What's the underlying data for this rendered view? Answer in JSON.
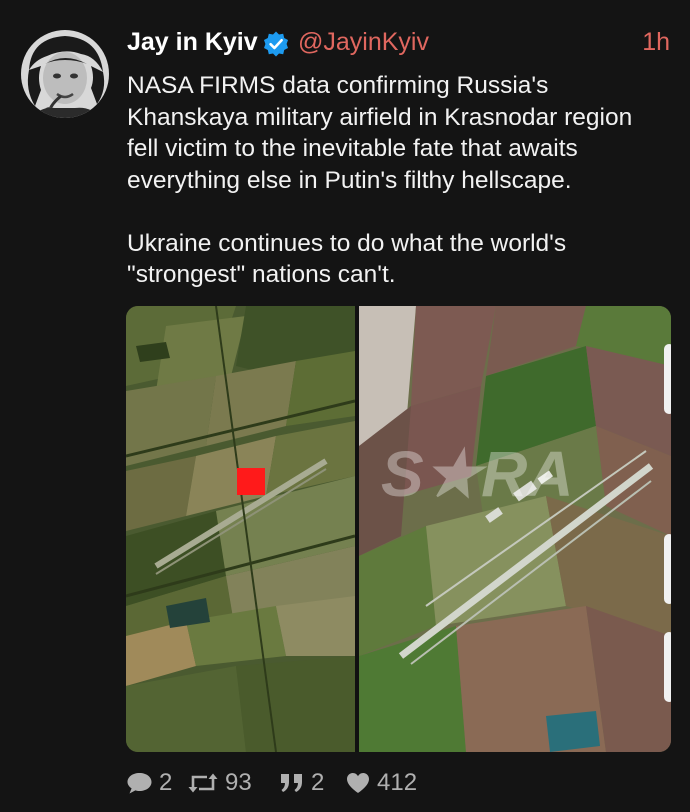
{
  "tweet": {
    "author_name": "Jay in Kyiv",
    "handle": "@JayinKyiv",
    "time": "1h",
    "text": "NASA FIRMS data confirming Russia's\nKhanskaya military airfield in Krasnodar region\nfell victim to the inevitable fate that awaits\neverything else in Putin's filthy hellscape.\n\nUkraine continues to do what the world's\n\"strongest\" nations can't.",
    "media": {
      "watermark": "S★RA"
    }
  },
  "actions": {
    "replies": "2",
    "retweets": "93",
    "quotes": "2",
    "likes": "412"
  },
  "colors": {
    "background": "#141414",
    "handle": "#e0675f",
    "verified": "#1d9bf0",
    "firms_marker": "#ff1a1a"
  },
  "icons": [
    "verified-badge-icon",
    "reply-icon",
    "retweet-icon",
    "quote-icon",
    "like-icon"
  ]
}
